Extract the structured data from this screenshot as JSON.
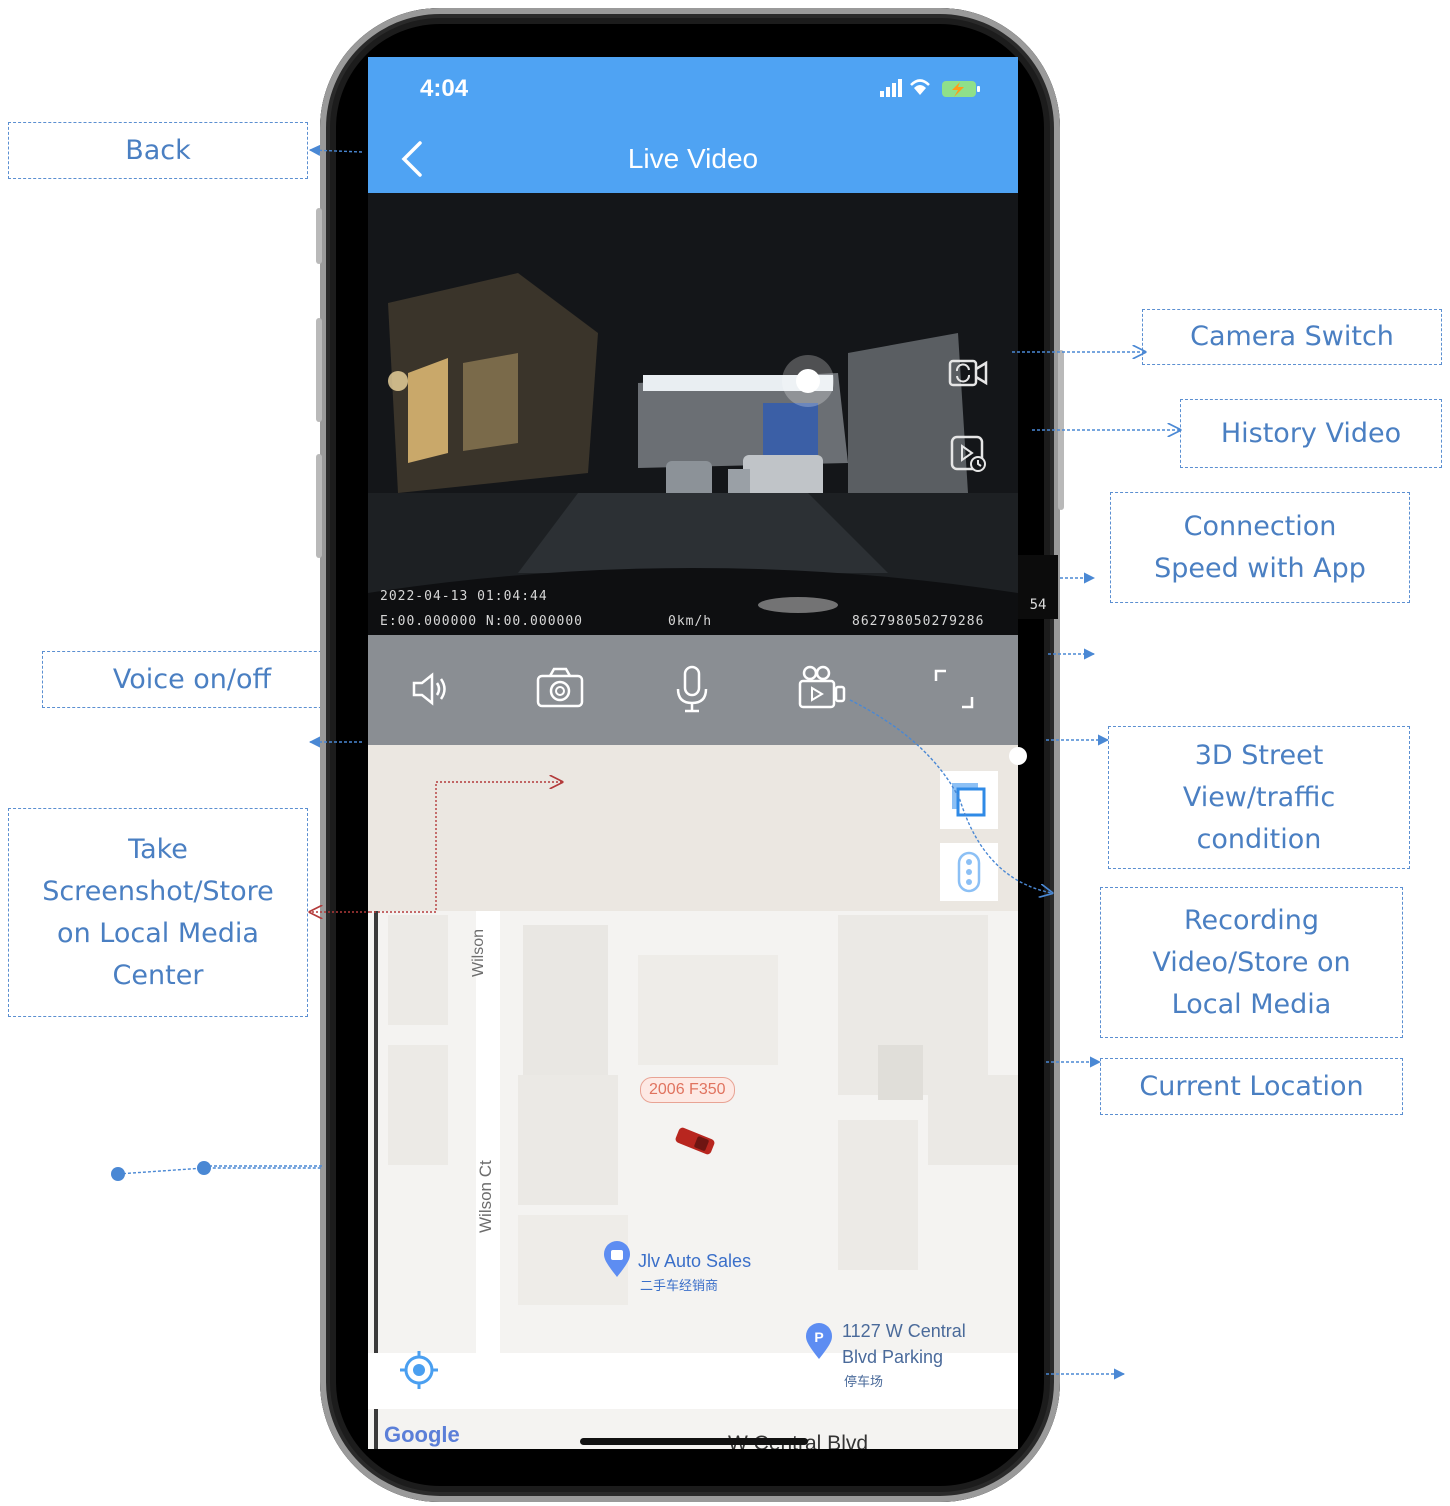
{
  "callouts": {
    "back": "Back",
    "camera_switch": "Camera Switch",
    "history_video": "History Video",
    "connection_speed": "Connection\nSpeed with App",
    "voice": "Voice on/off",
    "street_view": "3D Street\nView/traffic\ncondition",
    "screenshot": "Take\nScreenshot/Store\non Local Media\nCenter",
    "recording": "Recording\nVideo/Store on\nLocal Media",
    "current_location": "Current Location"
  },
  "status_bar": {
    "time": "4:04"
  },
  "header": {
    "title": "Live Video"
  },
  "video": {
    "datetime": "2022-04-13 01:04:44",
    "coords": "E:00.000000 N:00.000000",
    "speed": "0km/h",
    "device_id": "862798050279286",
    "speed_badge": "54"
  },
  "map": {
    "vehicle_label": "2006 F350",
    "street_vertical_top": "Wilson",
    "street_vertical": "Wilson Ct",
    "poi_1_name": "Jlv Auto Sales",
    "poi_1_sub": "二手车经销商",
    "poi_2_line1": "1127 W Central",
    "poi_2_line2": "Blvd Parking",
    "poi_2_sub": "停车场",
    "street_bottom": "W Central Blvd",
    "google": "Google"
  },
  "colors": {
    "header_blue": "#4fa3f3",
    "callout_text": "#4a7fc2",
    "controls_gray": "#8a8e93"
  }
}
